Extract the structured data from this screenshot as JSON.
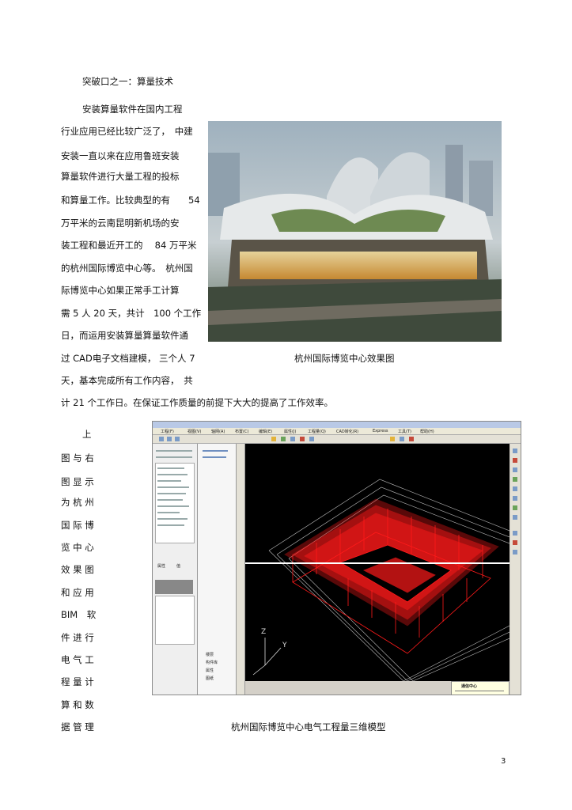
{
  "heading": "突破口之一：算量技术",
  "para1": [
    "安装算量软件在国内工程",
    "行业应用已经比较广泛了，　中建",
    "安装一直以来在应用鲁班安装",
    "算量软件进行大量工程的投标",
    "和算量工作。比较典型的有　　54",
    "万平米的云南昆明新机场的安",
    "装工程和最近开工的　 84 万平米",
    "的杭州国际博览中心等。　杭州国",
    "际博览中心如果正常手工计算",
    "需 5 人 20 天，共计　100 个工作",
    "日，而运用安装算量算量软件通",
    "过 CAD电子文档建模，  三个人  7",
    "天，基本完成所有工作内容，　共",
    "计 21 个工作日。在保证工作质量的前提下大大的提高了工作效率。"
  ],
  "caption1": "杭州国际博览中心效果图",
  "para2_vertical": [
    "上",
    "图 与 右",
    "图 显 示",
    "为 杭 州",
    "国 际 博",
    "览 中 心",
    "效 果 图",
    "和 应 用",
    "BIM　软",
    "件 进 行",
    "电 气 工",
    "程 量 计",
    "算 和 数",
    "据 管 理"
  ],
  "caption2": "杭州国际博览中心电气工程量三维模型",
  "page_number": "3",
  "cad": {
    "axis_z": "Z",
    "axis_y": "Y",
    "popup_title": "通信中心",
    "menu": [
      "工程(F)",
      "视图(V)",
      "轴网(A)",
      "布置(C)",
      "编辑(E)",
      "属性(J)",
      "工程量(Q)",
      "CAD转化(R)",
      "Express",
      "工具(T)",
      "帮助(H)"
    ],
    "left_tabs": [
      "属性",
      "值"
    ],
    "bottom_tabs": [
      "楼层",
      "构件库",
      "属性",
      "图纸"
    ]
  },
  "colors": {
    "model": "#ff1a1a",
    "viewport": "#000000"
  }
}
